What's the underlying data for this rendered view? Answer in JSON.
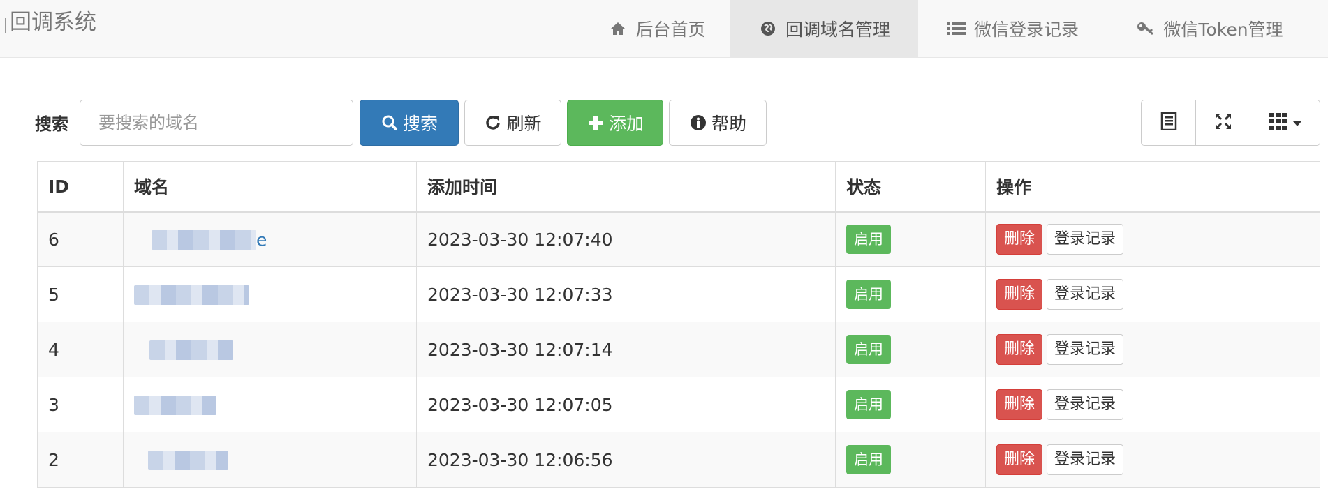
{
  "app": {
    "brand": "回调系统"
  },
  "nav": {
    "items": [
      {
        "label": "后台首页",
        "icon": "home-icon",
        "active": false
      },
      {
        "label": "回调域名管理",
        "icon": "globe-icon",
        "active": true
      },
      {
        "label": "微信登录记录",
        "icon": "list-icon",
        "active": false
      },
      {
        "label": "微信Token管理",
        "icon": "key-icon",
        "active": false
      }
    ]
  },
  "toolbar": {
    "search_label": "搜索",
    "search_placeholder": "要搜索的域名",
    "search_value": "",
    "search_button": "搜索",
    "refresh_button": "刷新",
    "add_button": "添加",
    "help_button": "帮助",
    "view_buttons": [
      "card-view-icon",
      "fullscreen-icon",
      "columns-icon"
    ]
  },
  "table": {
    "columns": [
      "ID",
      "域名",
      "添加时间",
      "状态",
      "操作"
    ],
    "rows": [
      {
        "id": "6",
        "domain_visible_suffix": "e",
        "added": "2023-03-30 12:07:40",
        "status": "启用",
        "delete": "删除",
        "log": "登录记录"
      },
      {
        "id": "5",
        "domain_visible_suffix": "",
        "added": "2023-03-30 12:07:33",
        "status": "启用",
        "delete": "删除",
        "log": "登录记录"
      },
      {
        "id": "4",
        "domain_visible_suffix": "",
        "added": "2023-03-30 12:07:14",
        "status": "启用",
        "delete": "删除",
        "log": "登录记录"
      },
      {
        "id": "3",
        "domain_visible_suffix": "",
        "added": "2023-03-30 12:07:05",
        "status": "启用",
        "delete": "删除",
        "log": "登录记录"
      },
      {
        "id": "2",
        "domain_visible_suffix": "",
        "added": "2023-03-30 12:06:56",
        "status": "启用",
        "delete": "删除",
        "log": "登录记录"
      }
    ]
  },
  "colors": {
    "primary": "#337ab7",
    "success": "#5cb85c",
    "danger": "#d9534f",
    "navbar_bg": "#f8f8f8",
    "active_tab_bg": "#e7e7e7"
  }
}
